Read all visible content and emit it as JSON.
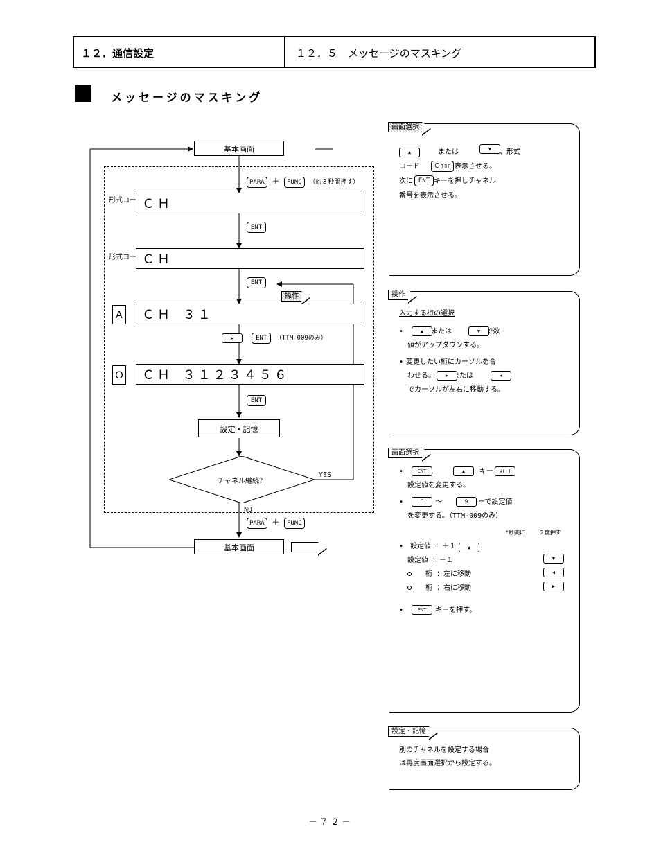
{
  "header": {
    "left": "１２．通信設定",
    "right": "１２．５　メッセージのマスキング"
  },
  "section": {
    "square": "■",
    "title": "　メッセージのマスキング"
  },
  "flow": {
    "basic": "基本画面",
    "combo_plus": "＋",
    "combo_right_label": "（約３秒間押す）",
    "k_para": "PARA",
    "k_func": "FUNC",
    "model_prefix1": "形式コード",
    "display1": "ＣＨ ",
    "k_ent": "ENT",
    "model_prefix2": "形式コード",
    "display2": "ＣＨ ",
    "k_ent2": "ENT",
    "action_tag": "操作",
    "box_a": "Ａ",
    "display3": "ＣＨ  ３１",
    "k_right": "▶",
    "k_ent3": "ENT",
    "box_o": "Ｏ",
    "display4": "ＣＨ  ３１２３４５６",
    "k_ent4": "ENT",
    "set_store": "設定・記憶",
    "diamond": "チャネル継続？",
    "yes": "YES",
    "no": "NO",
    "combo2_plus": "＋",
    "basic2": "基本画面"
  },
  "panelA": {
    "tag": "画面選択",
    "line1a": "　　または　　　キーで、形式",
    "line1b": "コード　　　　を表示させる。",
    "line1c": "次に　　　キーを押しチャネル",
    "line1d": "番号を表示させる。",
    "code": "Ｃ▯▯▯",
    "k_up": "▲",
    "k_dn": "▼",
    "k_ent": "ENT"
  },
  "panelB": {
    "tag": "操作",
    "title": "入力する桁の選択",
    "b1": "　　　または　　　キーで数",
    "b1b": "値がアップダウンする。",
    "b2": "変更したい桁にカーソルを合",
    "b2b": "わせる。　　　または　　　キー",
    "b2c": "でカーソルが左右に移動する。",
    "k_up": "▲",
    "k_dn": "▼",
    "k_r": "▶",
    "k_l": "◀"
  },
  "panelC": {
    "tag": "画面選択",
    "c1a": "　　　、　　　、　　　キーで",
    "c1b": "設定値を変更する。",
    "c2a": "　　　 ～ 　　　 キーで設定値",
    "c2b": "を変更する。（TTM-009のみ）",
    "note_sp_top": "*秒間に",
    "note_sp_top2": "２度押す",
    "t_ent": "ENT",
    "t_inc": "▲",
    "t_dec": "▼",
    "t_l": "◀",
    "t_r": "▶",
    "num0": "０",
    "num9": "９",
    "li_inc_a": "設定値 ：＋１　　　",
    "li_dec_a": "設定値 ：－１　　　",
    "li_l": "　桁     ：左に移動",
    "li_r": "　桁     ：右に移動",
    "c3": "　　　 キーを押す。",
    "sp_sym": "↲(-)"
  },
  "panelD": {
    "tag": "設定・記憶",
    "d1": "別のチャネルを設定する場合",
    "d2": "は再度画面選択から設定する。"
  },
  "footer": "－７２－"
}
